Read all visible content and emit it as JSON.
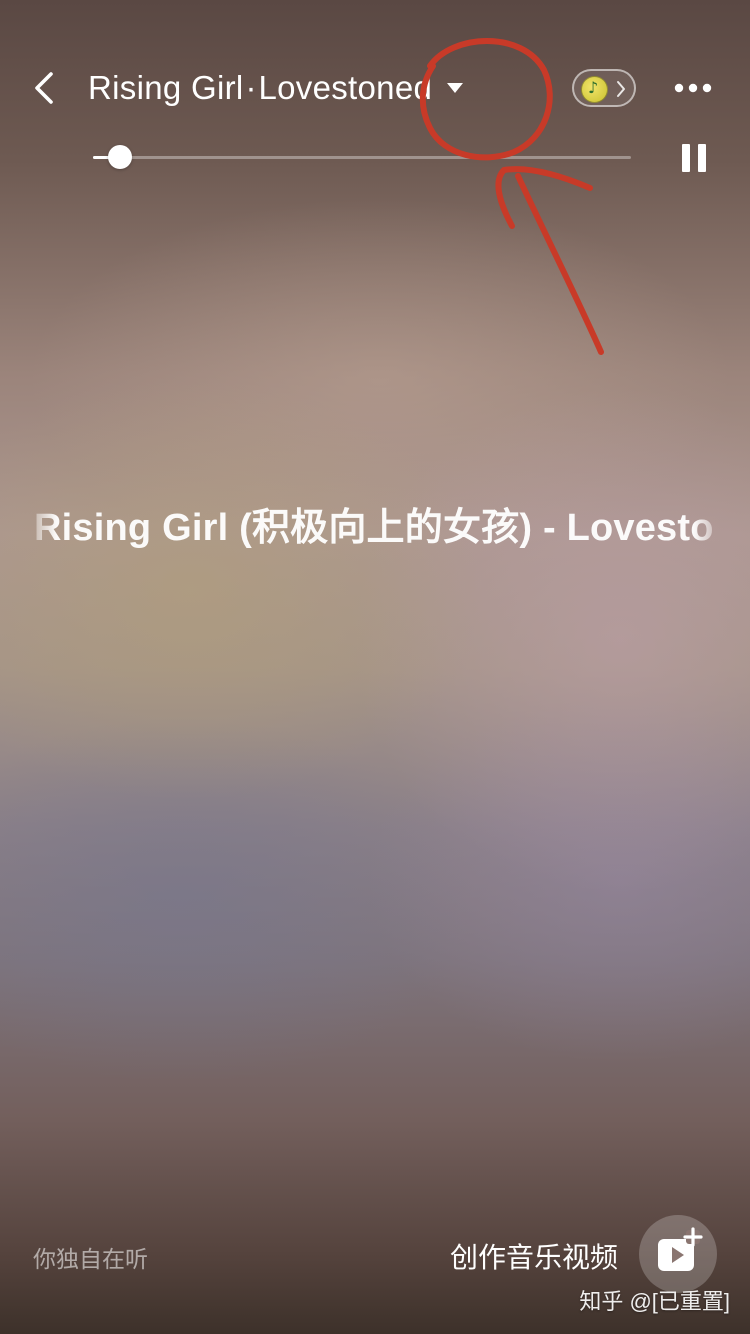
{
  "header": {
    "song_title": "Rising Girl",
    "separator": "·",
    "artist": "Lovestoned",
    "badge_icon": "qq-music-icon",
    "more_icon": "more-horizontal-icon"
  },
  "player": {
    "progress_fraction": 0.05,
    "state_icon": "pause-icon"
  },
  "lyrics": {
    "scrolling_title": "Rising Girl (积极向上的女孩) - Lovestoned"
  },
  "footer": {
    "listen_status": "你独自在听",
    "create_label": "创作音乐视频",
    "create_icon": "video-add-icon"
  },
  "watermark": {
    "text": "知乎 @[已重置]"
  },
  "annotation": {
    "color": "#c83a28"
  }
}
